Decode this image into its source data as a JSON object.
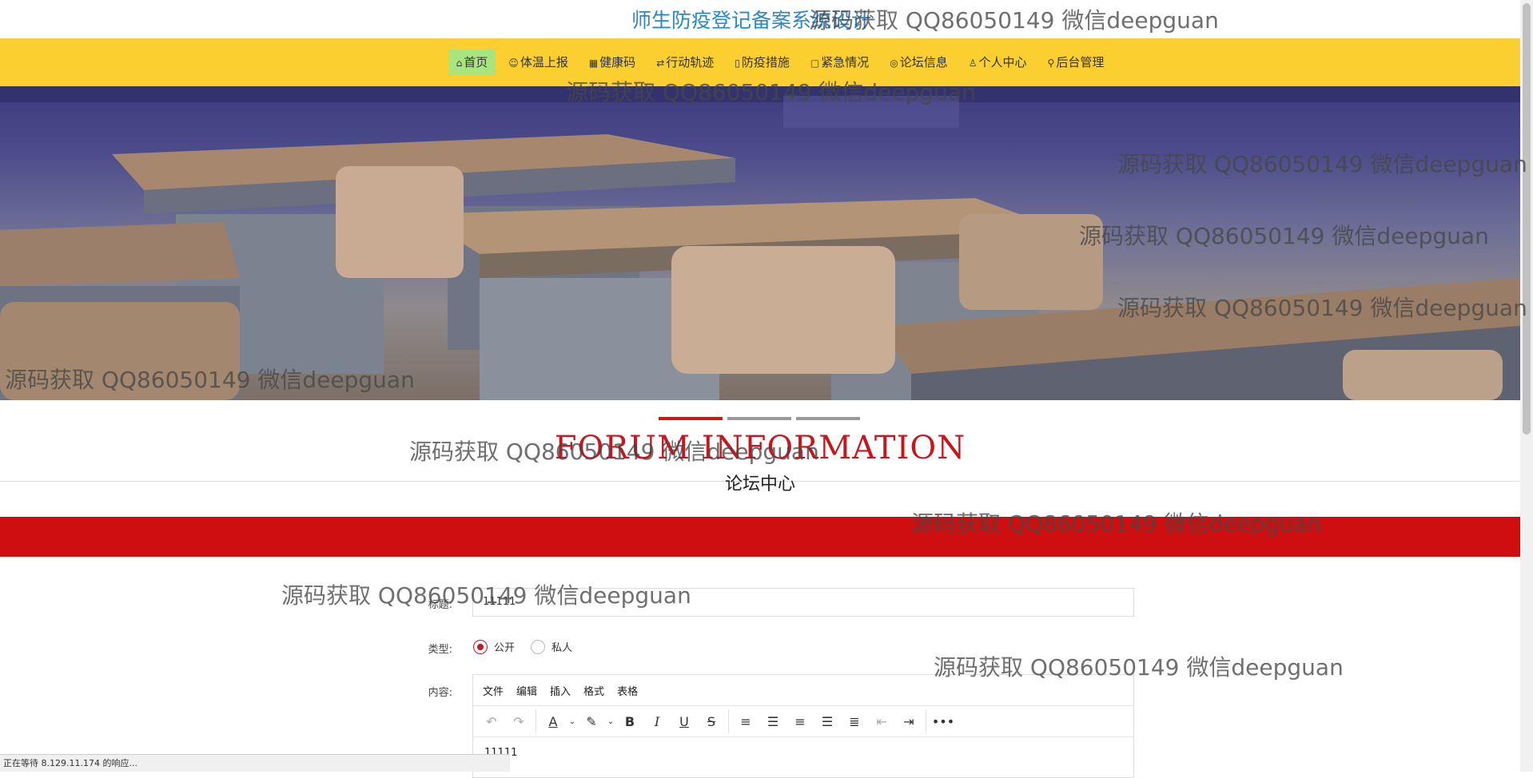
{
  "site": {
    "title": "师生防疫登记备案系统设计"
  },
  "nav": {
    "items": [
      {
        "icon": "⌂",
        "label": "首页"
      },
      {
        "icon": "☺",
        "label": "体温上报"
      },
      {
        "icon": "▦",
        "label": "健康码"
      },
      {
        "icon": "⇄",
        "label": "行动轨迹"
      },
      {
        "icon": "▯",
        "label": "防疫措施"
      },
      {
        "icon": "▢",
        "label": "紧急情况"
      },
      {
        "icon": "◎",
        "label": "论坛信息"
      },
      {
        "icon": "♙",
        "label": "个人中心"
      },
      {
        "icon": "⚲",
        "label": "后台管理"
      }
    ],
    "active_index": 0
  },
  "carousel": {
    "count": 3,
    "active_index": 0
  },
  "section": {
    "title_en": "FORUM   INFORMATION",
    "title_cn": "论坛中心"
  },
  "form": {
    "title_label": "标题:",
    "title_value": "11111",
    "type_label": "类型:",
    "type_options": [
      "公开",
      "私人"
    ],
    "type_selected": "公开",
    "content_label": "内容:",
    "editor": {
      "menus": [
        "文件",
        "编辑",
        "插入",
        "格式",
        "表格"
      ],
      "content": "11111"
    }
  },
  "status_bar": "正在等待 8.129.11.174 的响应...",
  "watermark": "源码获取 QQ86050149 微信deepguan",
  "colors": {
    "accent": "#c8161d",
    "nav_bg": "#fbcf2f",
    "nav_active": "#a8e57e",
    "title_blue": "#2a88c8"
  }
}
